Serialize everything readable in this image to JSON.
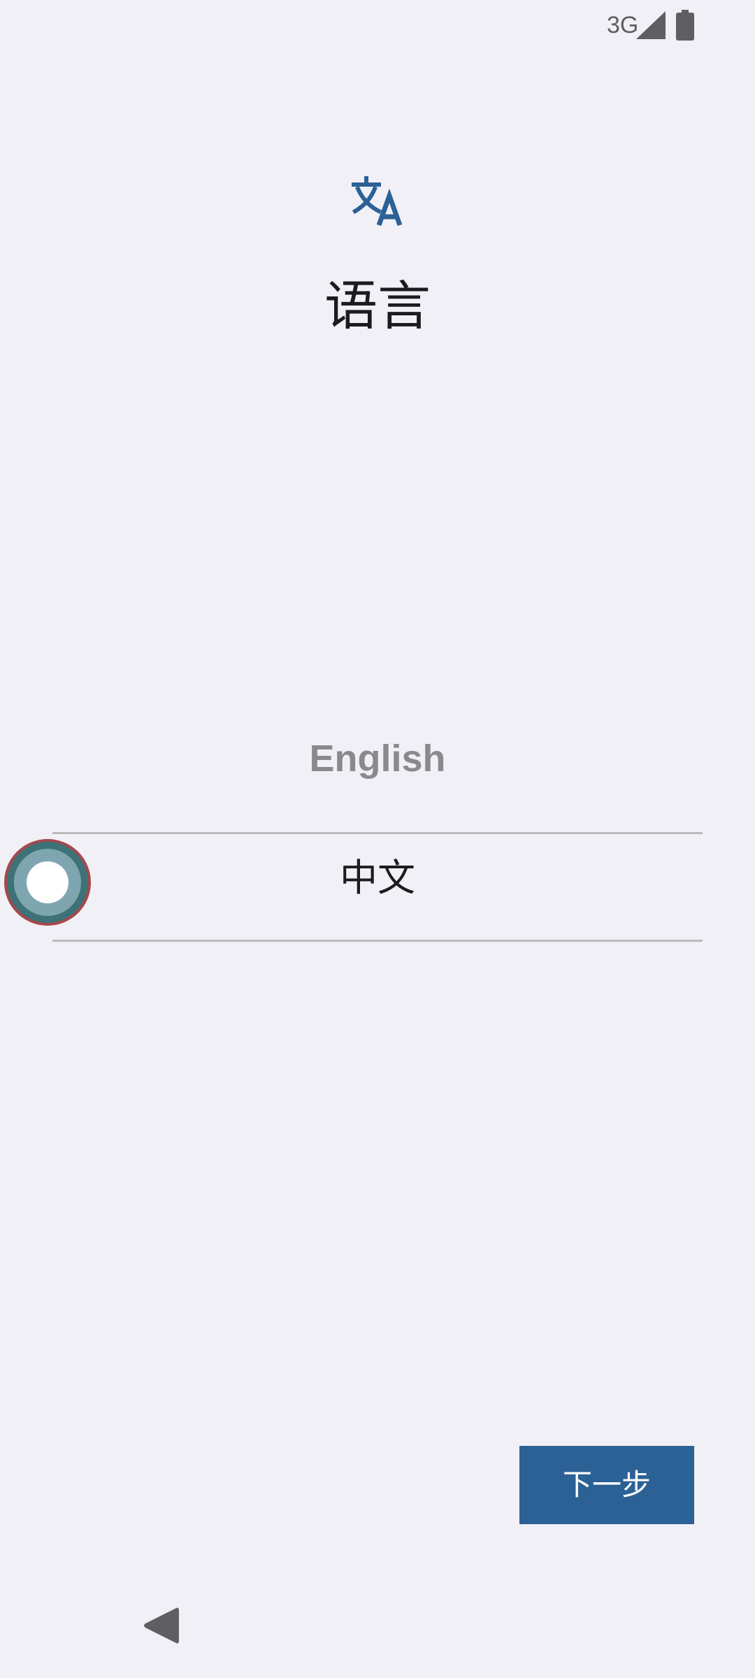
{
  "status_bar": {
    "network": "3G",
    "signal_icon": "signal-icon",
    "battery_icon": "battery-icon"
  },
  "header": {
    "icon": "translate-icon",
    "title": "语言"
  },
  "language_picker": {
    "options": [
      {
        "label": "English",
        "selected": false
      },
      {
        "label": "中文",
        "selected": true
      }
    ]
  },
  "actions": {
    "next_label": "下一步"
  },
  "nav_bar": {
    "back_icon": "back-icon"
  },
  "colors": {
    "background": "#f1f0f6",
    "accent": "#2c6195",
    "text_primary": "#1c1b1f",
    "text_secondary": "#8a8a8e",
    "divider": "#b9b9be"
  }
}
